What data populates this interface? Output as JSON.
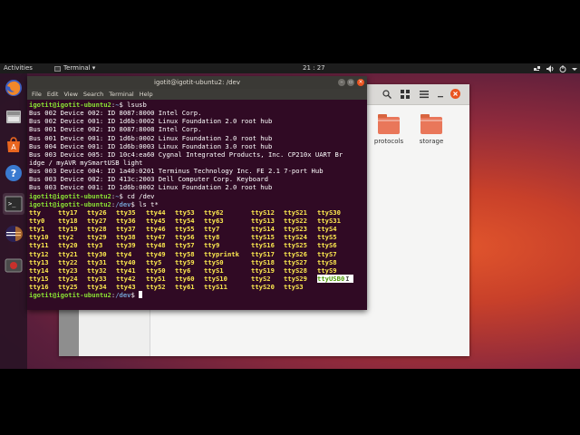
{
  "topbar": {
    "activities": "Activities",
    "app_menu": "Terminal ▾",
    "clock": "21 : 27"
  },
  "launcher": {
    "items": [
      {
        "icon": "firefox-icon"
      },
      {
        "icon": "files-icon"
      },
      {
        "icon": "software-center-icon"
      },
      {
        "icon": "help-icon"
      },
      {
        "icon": "terminal-icon"
      },
      {
        "icon": "eclipse-icon"
      },
      {
        "icon": "screenshot-icon"
      }
    ]
  },
  "files": {
    "folders": [
      {
        "label": "protocols"
      },
      {
        "label": "storage"
      }
    ]
  },
  "terminal": {
    "title": "igotit@igotit-ubuntu2: /dev",
    "menu": [
      "File",
      "Edit",
      "View",
      "Search",
      "Terminal",
      "Help"
    ],
    "prompts": [
      {
        "user": "igotit@igotit-ubuntu2",
        "dir": "~",
        "cmd": " lsusb"
      },
      {
        "user": "igotit@igotit-ubuntu2",
        "dir": "~",
        "cmd": " cd /dev"
      },
      {
        "user": "igotit@igotit-ubuntu2",
        "dir": "/dev",
        "cmd": " ls t*"
      },
      {
        "user": "igotit@igotit-ubuntu2",
        "dir": "/dev",
        "cmd": " "
      }
    ],
    "lsusb_output": [
      "Bus 002 Device 002: ID 8087:8000 Intel Corp.",
      "Bus 002 Device 001: ID 1d6b:0002 Linux Foundation 2.0 root hub",
      "Bus 001 Device 002: ID 8087:8008 Intel Corp.",
      "Bus 001 Device 001: ID 1d6b:0002 Linux Foundation 2.0 root hub",
      "Bus 004 Device 001: ID 1d6b:0003 Linux Foundation 3.0 root hub",
      "Bus 003 Device 005: ID 10c4:ea60 Cygnal Integrated Products, Inc. CP210x UART Br",
      "idge / myAVR mySmartUSB light",
      "Bus 003 Device 004: ID 1a40:0201 Terminus Technology Inc. FE 2.1 7-port Hub",
      "Bus 003 Device 002: ID 413c:2003 Dell Computer Corp. Keyboard",
      "Bus 003 Device 001: ID 1d6b:0002 Linux Foundation 2.0 root hub"
    ],
    "ls_columns": [
      [
        "tty",
        "tty0",
        "tty1",
        "tty10",
        "tty11",
        "tty12",
        "tty13",
        "tty14",
        "tty15",
        "tty16"
      ],
      [
        "tty17",
        "tty18",
        "tty19",
        "tty2",
        "tty20",
        "tty21",
        "tty22",
        "tty23",
        "tty24",
        "tty25"
      ],
      [
        "tty26",
        "tty27",
        "tty28",
        "tty29",
        "tty3",
        "tty30",
        "tty31",
        "tty32",
        "tty33",
        "tty34"
      ],
      [
        "tty35",
        "tty36",
        "tty37",
        "tty38",
        "tty39",
        "tty4",
        "tty40",
        "tty41",
        "tty42",
        "tty43"
      ],
      [
        "tty44",
        "tty45",
        "tty46",
        "tty47",
        "tty48",
        "tty49",
        "tty5",
        "tty50",
        "tty51",
        "tty52"
      ],
      [
        "tty53",
        "tty54",
        "tty55",
        "tty56",
        "tty57",
        "tty58",
        "tty59",
        "tty6",
        "tty60",
        "tty61"
      ],
      [
        "tty62",
        "tty63",
        "tty7",
        "tty8",
        "tty9",
        "ttyprintk",
        "ttyS0",
        "ttyS1",
        "ttyS10",
        "ttyS11"
      ],
      [
        "ttyS12",
        "ttyS13",
        "ttyS14",
        "ttyS15",
        "ttyS16",
        "ttyS17",
        "ttyS18",
        "ttyS19",
        "ttyS2",
        "ttyS20"
      ],
      [
        "ttyS21",
        "ttyS22",
        "ttyS23",
        "ttyS24",
        "ttyS25",
        "ttyS26",
        "ttyS27",
        "ttyS28",
        "ttyS29",
        "ttyS3"
      ],
      [
        "ttyS30",
        "ttyS31",
        "ttyS4",
        "ttyS5",
        "ttyS6",
        "ttyS7",
        "ttyS8",
        "ttyS9",
        "ttyUSB0",
        ""
      ]
    ],
    "highlighted_entry": "ttyUSB0"
  },
  "colors": {
    "terminal_bg": "#300a24",
    "prompt_user": "#8ae234",
    "prompt_dir": "#729fcf",
    "ls_entry": "#fce94f",
    "accent_close": "#e95420"
  }
}
